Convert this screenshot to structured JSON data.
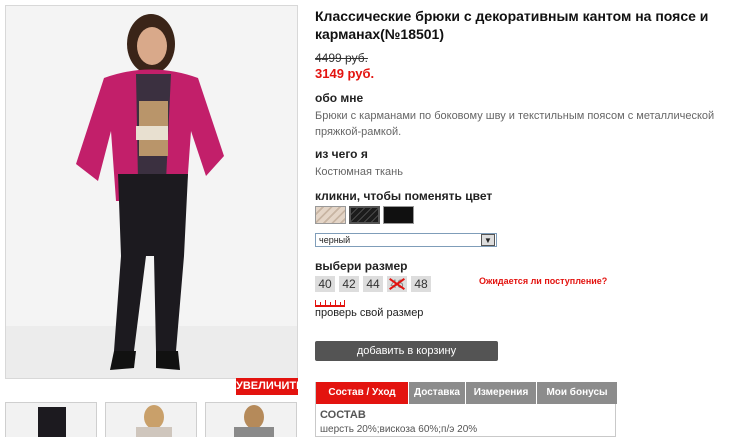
{
  "product": {
    "title": "Классические брюки с декоративным кантом на поясе и карманах(№18501)",
    "old_price": "4499 руб.",
    "new_price": "3149 руб."
  },
  "about": {
    "heading": "обо мне",
    "text": "Брюки с карманами по боковому шву и текстильным поясом с металлической пряжкой-рамкой."
  },
  "material": {
    "heading": "из чего я",
    "text": "Костюмная ткань"
  },
  "color": {
    "heading": "кликни, чтобы поменять цвет",
    "swatches": [
      {
        "name": "beige-stripe",
        "color": "#d8c6b6"
      },
      {
        "name": "black-stripe",
        "color": "#1c1c1c"
      },
      {
        "name": "black",
        "color": "#101010"
      }
    ],
    "selected_value": "черный"
  },
  "size": {
    "heading": "выбери размер",
    "options": [
      "40",
      "42",
      "44",
      "46",
      "48"
    ],
    "unavailable": [
      "46"
    ],
    "awaiting_link": "Ожидается ли поступление?",
    "check_size_link": "проверь свой размер"
  },
  "actions": {
    "zoom_label": "УВЕЛИЧИТЬ",
    "add_to_cart_label": "добавить в корзину"
  },
  "tabs": {
    "items": [
      "Состав / Уход",
      "Доставка",
      "Измерения",
      "Мои бонусы"
    ],
    "active_index": 0,
    "content_heading": "СОСТАВ",
    "content_text": "шерсть 20%;вискоза 60%;п/э 20%"
  },
  "colors": {
    "accent": "#e3130f",
    "button": "#545454",
    "tab_inactive": "#8c8c8c"
  }
}
